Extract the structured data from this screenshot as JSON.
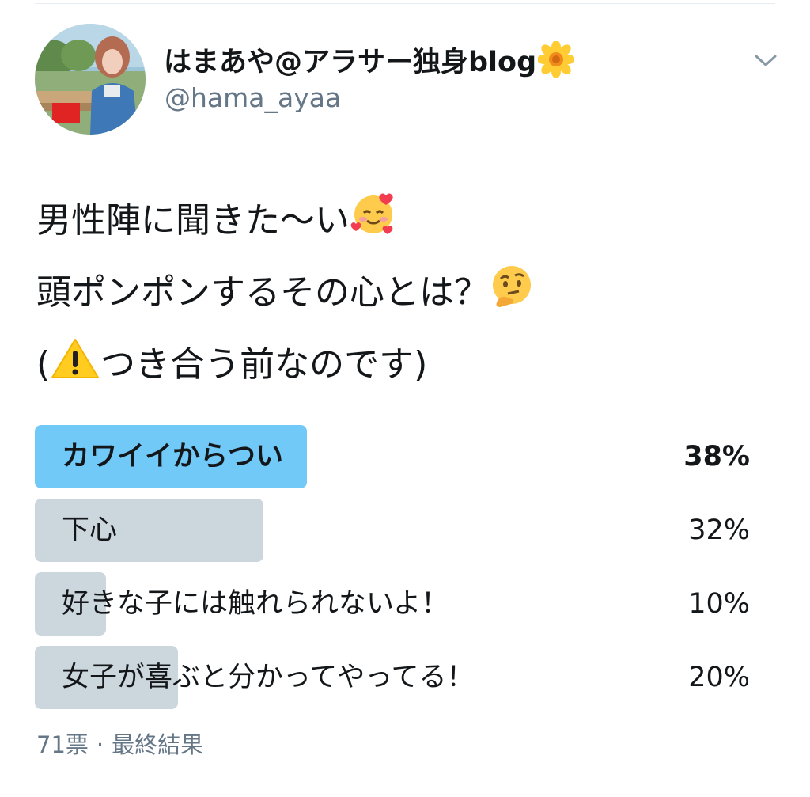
{
  "user": {
    "display_name": "はまあや@アラサー独身blog",
    "name_emoji": "sunflower-emoji",
    "handle": "@hama_ayaa"
  },
  "menu": {
    "icon": "chevron-down-icon"
  },
  "tweet": {
    "line1": "男性陣に聞きた〜い",
    "line1_emoji": "smiling-face-with-hearts-emoji",
    "line2": "頭ポンポンするその心とは？",
    "line2_emoji": "thinking-face-emoji",
    "line3_open": "(",
    "line3_emoji": "warning-emoji",
    "line3_text": "つき合う前なのです)"
  },
  "poll": {
    "options": [
      {
        "label": "カワイイからつい",
        "percent_text": "38%",
        "share": 0.38,
        "winner": true
      },
      {
        "label": "下心",
        "percent_text": "32%",
        "share": 0.32,
        "winner": false
      },
      {
        "label": "好きな子には触れられないよ！",
        "percent_text": "10%",
        "share": 0.1,
        "winner": false
      },
      {
        "label": "女子が喜ぶと分かってやってる！",
        "percent_text": "20%",
        "share": 0.2,
        "winner": false
      }
    ],
    "votes": "71票",
    "separator": "·",
    "status": "最終結果"
  },
  "colors": {
    "winner_bar": "#71c9f8",
    "bar": "#ccd6dd",
    "secondary_text": "#657786",
    "primary_text": "#14171a"
  }
}
